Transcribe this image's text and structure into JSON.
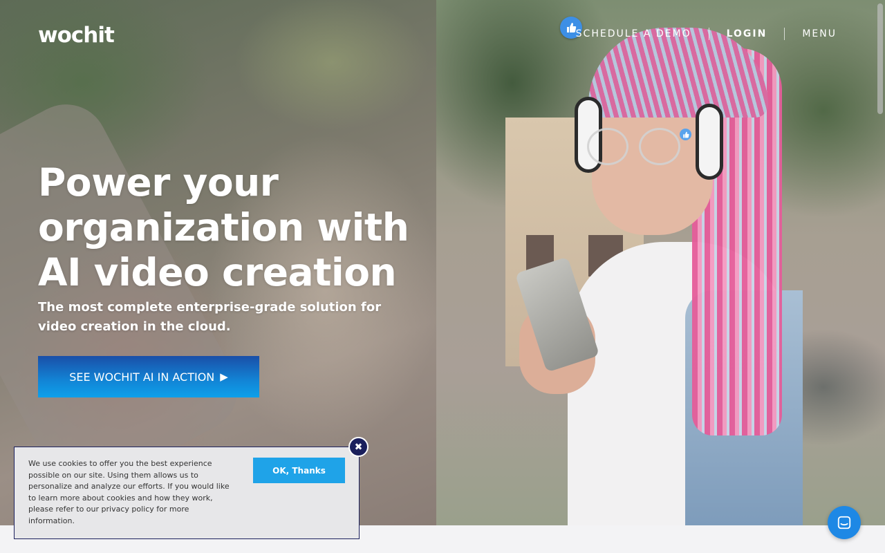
{
  "header": {
    "logo_text": "wochit",
    "nav": {
      "schedule_demo": "SCHEDULE A DEMO",
      "login": "LOGIN",
      "menu": "MENU"
    }
  },
  "hero": {
    "headline": "Power your organization with AI video creation",
    "subheadline": "The most complete enterprise-grade solution for video creation in the cloud.",
    "cta_label": "SEE WOCHIT AI IN ACTION",
    "cta_icon": "play-icon"
  },
  "cookie_banner": {
    "text": "We use cookies to offer you the best experience possible on our site. Using them allows us to personalize and analyze our efforts. If you would like to learn more about cookies and how they work, please refer to our privacy policy for more information.",
    "ok_label": "OK, Thanks",
    "close_icon": "close-icon"
  },
  "widgets": {
    "chat_icon": "chat-icon",
    "like_icon": "thumbs-up-icon"
  },
  "colors": {
    "cta_top": "#1a4fa8",
    "cta_bottom": "#0ea0ea",
    "cookie_button": "#1fa3e8",
    "cookie_border": "#1a1f5c",
    "chat_button": "#1e88e5"
  }
}
